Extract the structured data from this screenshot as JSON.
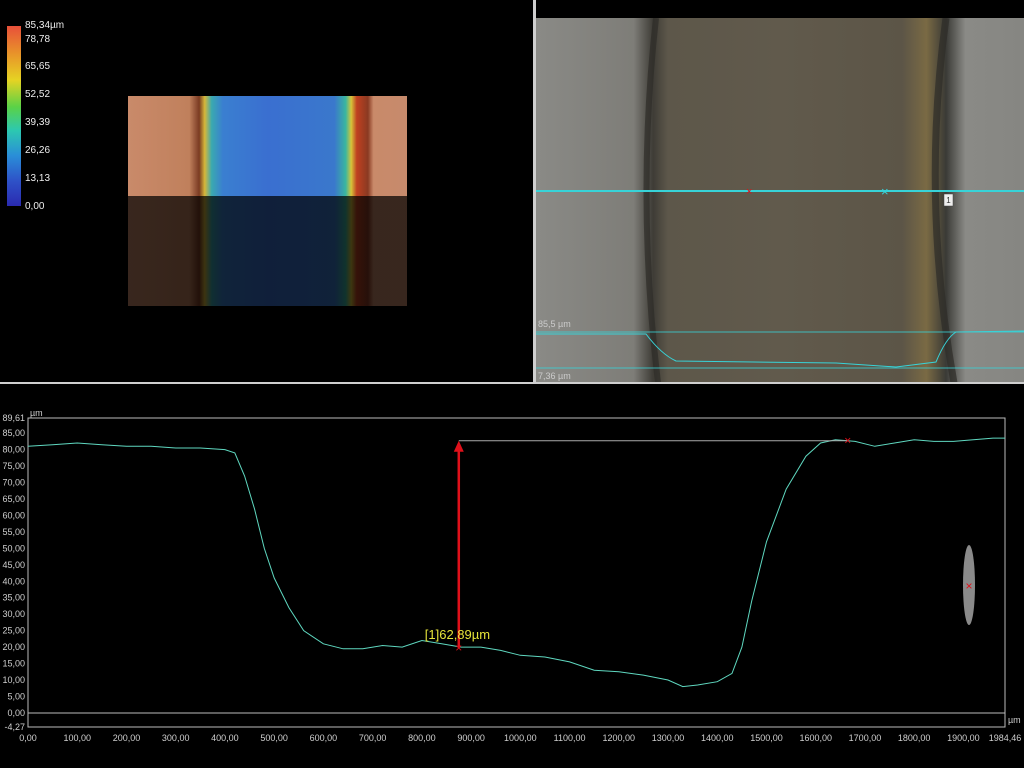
{
  "scale": {
    "labels": [
      "85,34µm",
      "78,78",
      "65,65",
      "52,52",
      "39,39",
      "26,26",
      "13,13",
      "0,00"
    ]
  },
  "image_view": {
    "top_level": "85,5 µm",
    "bottom_level": "7,36 µm",
    "marker_label": "1"
  },
  "profile": {
    "y_unit": "µm",
    "x_unit": "µm",
    "measurement_label": "[1]62,89µm",
    "colors": {
      "profile": "#5fd8c0",
      "measure": "#e0101a",
      "label": "#e6e43a"
    }
  },
  "chart_data": {
    "type": "line",
    "xlabel": "µm",
    "ylabel": "µm",
    "xlim": [
      0,
      1984.46
    ],
    "ylim": [
      -4.27,
      89.61
    ],
    "x_ticks": [
      "0,00",
      "100,00",
      "200,00",
      "300,00",
      "400,00",
      "500,00",
      "600,00",
      "700,00",
      "800,00",
      "900,00",
      "1000,00",
      "1100,00",
      "1200,00",
      "1300,00",
      "1400,00",
      "1500,00",
      "1600,00",
      "1700,00",
      "1800,00",
      "1900,00",
      "1984,46"
    ],
    "y_ticks": [
      "89,61",
      "85,00",
      "80,00",
      "75,00",
      "70,00",
      "65,00",
      "60,00",
      "55,00",
      "50,00",
      "45,00",
      "40,00",
      "35,00",
      "30,00",
      "25,00",
      "20,00",
      "15,00",
      "10,00",
      "5,00",
      "0,00",
      "-4,27"
    ],
    "series": [
      {
        "x": [
          0,
          50,
          100,
          150,
          200,
          250,
          300,
          350,
          400,
          420,
          440,
          460,
          480,
          500,
          530,
          560,
          600,
          640,
          680,
          720,
          760,
          800,
          840,
          880,
          920,
          960,
          1000,
          1050,
          1100,
          1150,
          1200,
          1250,
          1300,
          1330,
          1360,
          1400,
          1430,
          1450,
          1470,
          1500,
          1540,
          1580,
          1610,
          1640,
          1680,
          1720,
          1760,
          1800,
          1840,
          1880,
          1920,
          1960,
          1984.46
        ],
        "y": [
          81,
          81.5,
          82,
          81.5,
          81,
          81,
          80.5,
          80.5,
          80,
          79,
          72,
          62,
          50,
          41,
          32,
          25,
          21,
          19.5,
          19.5,
          20.5,
          20,
          22,
          21,
          20,
          20,
          19,
          17.5,
          17,
          15.5,
          13,
          12.5,
          11.5,
          10,
          8,
          8.5,
          9.5,
          12,
          20,
          34,
          52,
          68,
          78,
          82,
          83,
          82.5,
          81,
          82,
          83,
          82.5,
          82.5,
          83,
          83.5,
          83.5
        ]
      }
    ],
    "annotations": [
      {
        "type": "height-measurement",
        "label": "[1]62,89µm",
        "x": 875,
        "y_from": 19.8,
        "y_to": 82.7
      },
      {
        "type": "marker",
        "x": 875,
        "y": 19.8
      },
      {
        "type": "marker",
        "x": 1665,
        "y": 82.7
      }
    ]
  }
}
